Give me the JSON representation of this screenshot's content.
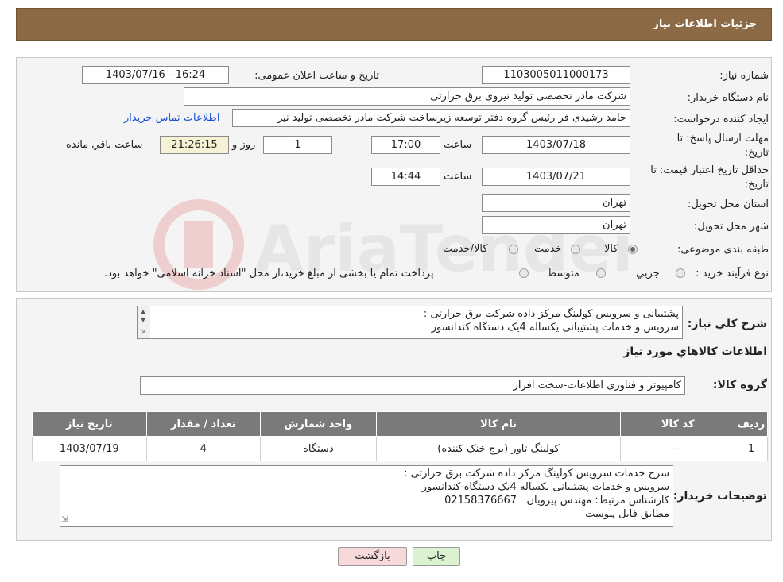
{
  "header": {
    "title": "جزئیات اطلاعات نیاز"
  },
  "form": {
    "need_number_label": "شماره نیاز:",
    "need_number": "1103005011000173",
    "announce_label": "تاریخ و ساعت اعلان عمومی:",
    "announce_value": "1403/07/16 - 16:24",
    "buyer_org_label": "نام دستگاه خریدار:",
    "buyer_org": "شرکت مادر تخصصی تولید نیروی برق حرارتی",
    "requester_label": "ایجاد کننده درخواست:",
    "requester": "حامد رشیدی فر رئیس گروه دفتر توسعه زیرساخت شرکت مادر تخصصی تولید نیر",
    "contact_link": "اطلاعات تماس خریدار",
    "deadline_label_1": "مهلت ارسال پاسخ: تا",
    "deadline_label_2": "تاریخ:",
    "deadline_date": "1403/07/18",
    "time_label": "ساعت",
    "deadline_time": "17:00",
    "days_value": "1",
    "days_label": "روز و",
    "remaining_time": "21:26:15",
    "remaining_label": "ساعت باقي مانده",
    "validity_label_1": "حداقل تاریخ اعتبار قیمت: تا",
    "validity_label_2": "تاریخ:",
    "validity_date": "1403/07/21",
    "validity_time": "14:44",
    "province_label": "استان محل تحویل:",
    "province": "تهران",
    "city_label": "شهر محل تحویل:",
    "city": "تهران",
    "category_label": "طبقه بندی موضوعی:",
    "category_options": [
      "کالا",
      "خدمت",
      "کالا/خدمت"
    ],
    "category_selected": 0,
    "process_label": "نوع فرآیند خرید :",
    "process_options": [
      "جزیي",
      "متوسط"
    ],
    "process_note": "پرداخت تمام یا بخشی از مبلغ خرید،از محل \"اسناد خزانه اسلامی\" خواهد بود."
  },
  "summary": {
    "label": "شرح کلي نیاز:",
    "lines": [
      "پشتیبانی و سرویس کولینگ مرکز داده شرکت برق حرارتی :",
      "سرویس و خدمات پشتیبانی یکساله 4یک دستگاه کندانسور"
    ]
  },
  "goods": {
    "section_title": "اطلاعات کالاهاي مورد نیاز",
    "group_label": "گروه کالا:",
    "group_value": "کامپیوتر و فناوری اطلاعات-سخت افزار",
    "columns": [
      "ردیف",
      "کد کالا",
      "نام کالا",
      "واحد شمارش",
      "تعداد / مقدار",
      "تاریخ نیاز"
    ],
    "rows": [
      [
        "1",
        "--",
        "کولینگ تاور (برج خنک کننده)",
        "دستگاه",
        "4",
        "1403/07/19"
      ]
    ]
  },
  "buyer_notes": {
    "label": "توضیحات خریدار:",
    "lines": [
      "شرح خدمات سرویس کولینگ مرکز داده شرکت برق حرارتی :",
      "سرویس و خدمات پشتیبانی یکساله 4یک دستگاه کندانسور",
      "کارشناس مرتبط: مهندس پیرویان   02158376667",
      "مطابق فایل پیوست"
    ]
  },
  "buttons": {
    "print": "چاپ",
    "back": "بازگشت"
  },
  "watermark": {
    "text": "AriaTender.neT"
  },
  "colors": {
    "header_bg": "#8b6a45",
    "table_header_bg": "#7a7a7a",
    "link": "#1a4fd6",
    "back_button_bg": "#f7d9dc",
    "print_button_bg": "#dcf3d2"
  }
}
